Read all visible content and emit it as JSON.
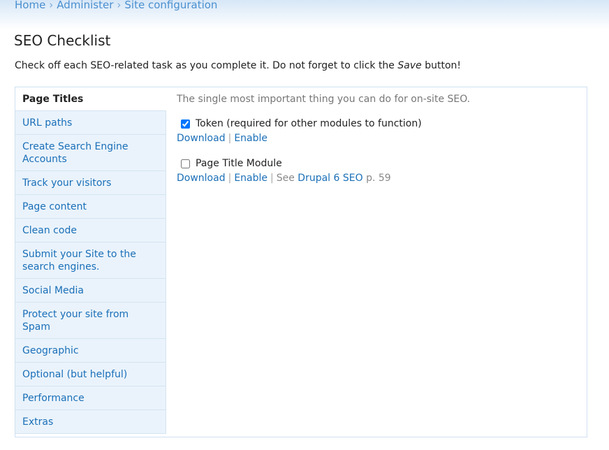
{
  "breadcrumb": {
    "home": "Home",
    "administer": "Administer",
    "site_configuration": "Site configuration",
    "separator": "›"
  },
  "page": {
    "title": "SEO Checklist",
    "intro_before": "Check off each SEO-related task as you complete it. Do not forget to click the ",
    "intro_em": "Save",
    "intro_after": " button!"
  },
  "tabs": [
    {
      "label": "Page Titles",
      "active": true
    },
    {
      "label": "URL paths"
    },
    {
      "label": "Create Search Engine Accounts"
    },
    {
      "label": "Track your visitors"
    },
    {
      "label": "Page content"
    },
    {
      "label": "Clean code"
    },
    {
      "label": "Submit your Site to the search engines."
    },
    {
      "label": "Social Media"
    },
    {
      "label": "Protect your site from Spam"
    },
    {
      "label": "Geographic"
    },
    {
      "label": "Optional (but helpful)"
    },
    {
      "label": "Performance"
    },
    {
      "label": "Extras"
    }
  ],
  "content": {
    "description": "The single most important thing you can do for on-site SEO.",
    "items": [
      {
        "label": "Token (required for other modules to function)",
        "checked": true,
        "download": "Download",
        "enable": "Enable",
        "pipe": "|"
      },
      {
        "label": "Page Title Module",
        "checked": false,
        "download": "Download",
        "enable": "Enable",
        "pipe": "|",
        "see_prefix": "See ",
        "book": "Drupal 6 SEO",
        "page_ref": " p. 59"
      }
    ]
  }
}
